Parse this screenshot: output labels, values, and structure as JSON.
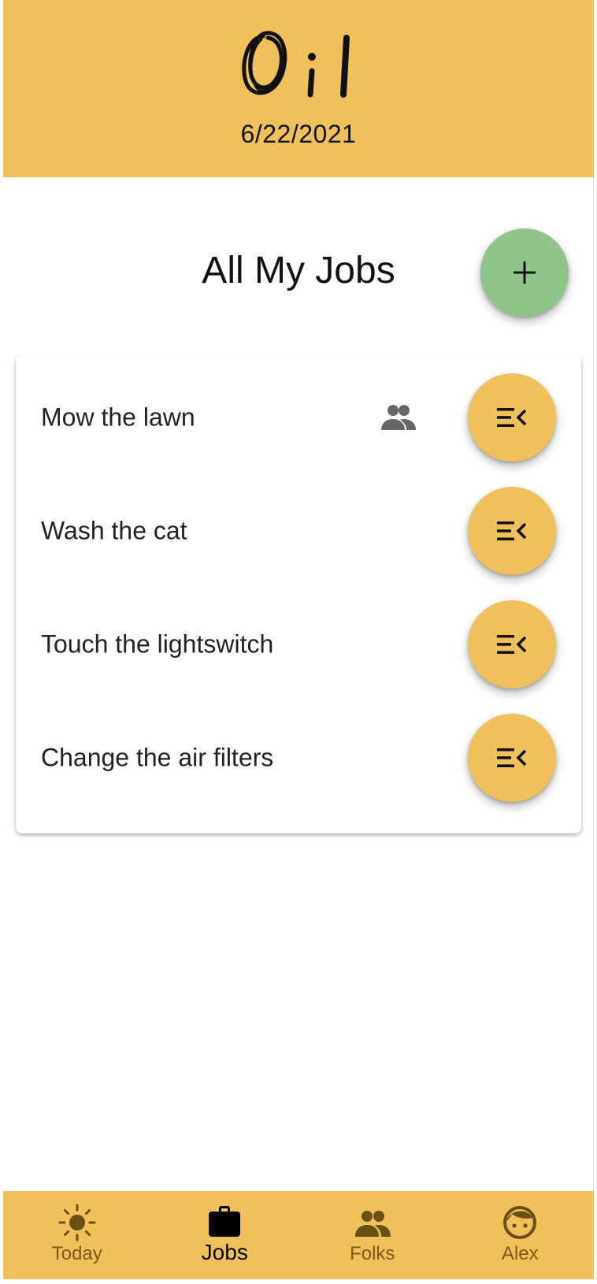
{
  "app": {
    "logo_text": "Oil",
    "date": "6/22/2021"
  },
  "main": {
    "title": "All My Jobs",
    "add_button_label": "+"
  },
  "jobs": [
    {
      "label": "Mow the lawn",
      "shared": true,
      "action_icon": "playlist-remove-icon"
    },
    {
      "label": "Wash the cat",
      "shared": false,
      "action_icon": "playlist-remove-icon"
    },
    {
      "label": "Touch the lightswitch",
      "shared": false,
      "action_icon": "playlist-remove-icon"
    },
    {
      "label": "Change the air filters",
      "shared": false,
      "action_icon": "playlist-remove-icon"
    }
  ],
  "nav": {
    "active": "Jobs",
    "items": [
      {
        "label": "Today",
        "icon": "sun-icon"
      },
      {
        "label": "Jobs",
        "icon": "briefcase-icon"
      },
      {
        "label": "Folks",
        "icon": "people-icon"
      },
      {
        "label": "Alex",
        "icon": "face-icon"
      }
    ]
  },
  "colors": {
    "accent": "#F0C05A",
    "add_button": "#8FC58A",
    "nav_inactive": "#7a5a1a"
  }
}
